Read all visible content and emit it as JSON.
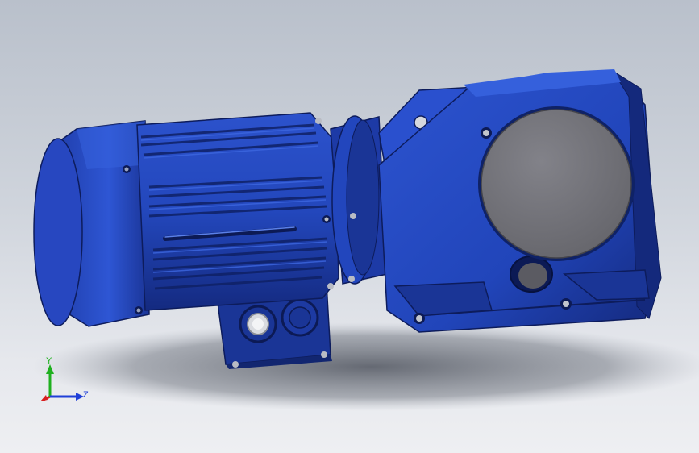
{
  "viewport": {
    "background_top": "#b9c0cb",
    "background_bottom": "#eeeff2"
  },
  "model": {
    "body_color": "#1f3fb0",
    "body_dark": "#13277a",
    "body_light": "#3d63d8",
    "shaft_cover_color": "#7a7a80",
    "components": [
      "motor-fan-cover",
      "motor-finned-body",
      "terminal-box",
      "adapter-flange",
      "gear-housing",
      "output-hollow-shaft"
    ]
  },
  "triad": {
    "y_label": "Y",
    "z_label": "Z",
    "x_color": "#d81f1f",
    "y_color": "#1fb01f",
    "z_color": "#1f3fd8"
  }
}
